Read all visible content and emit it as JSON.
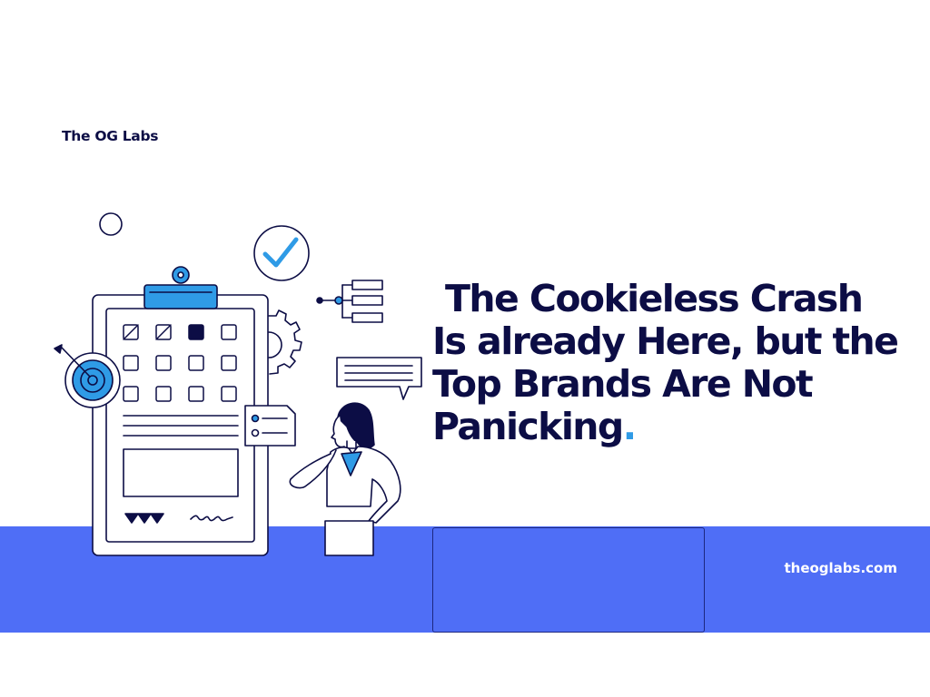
{
  "brand": {
    "name": "The OG Labs"
  },
  "headline": {
    "line1": "The Cookieless Crash",
    "line2": "Is already Here, but the",
    "line3": "Top Brands Are Not",
    "line4": "Panicking",
    "end_dot": "."
  },
  "footer": {
    "website": "theoglabs.com"
  },
  "colors": {
    "navy": "#0c0d45",
    "band_blue": "#4f6ef6",
    "accent_blue": "#2f9be6",
    "white": "#ffffff"
  },
  "illustration": {
    "icons": [
      "clipboard-icon",
      "target-icon",
      "checkmark-icon",
      "gear-icon",
      "flowchart-icon",
      "chat-bubble-icon",
      "note-card-icon",
      "woman-thinking-figure"
    ],
    "signature_text": "ele"
  }
}
